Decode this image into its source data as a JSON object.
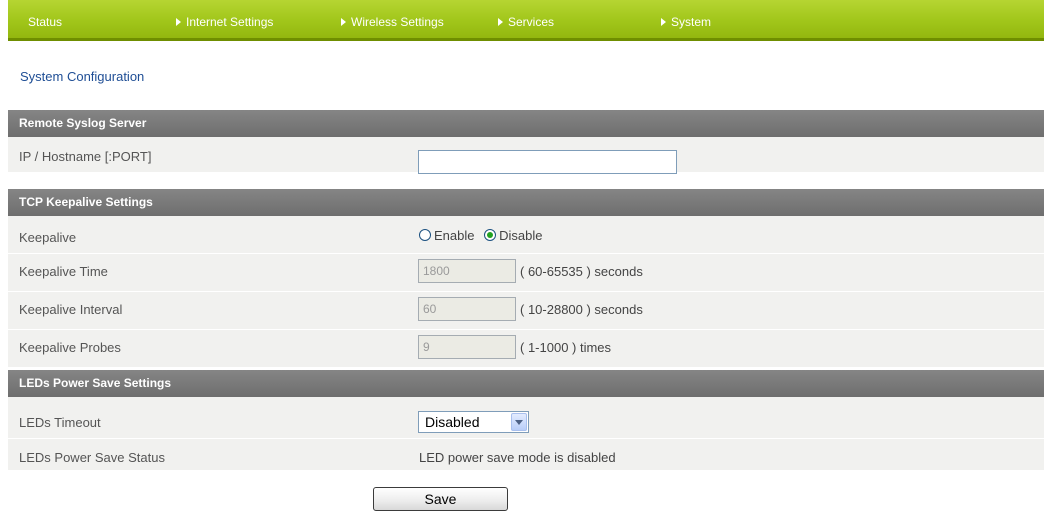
{
  "nav": {
    "items": [
      {
        "label": "Status",
        "arrow": false
      },
      {
        "label": "Internet Settings",
        "arrow": true
      },
      {
        "label": "Wireless Settings",
        "arrow": true
      },
      {
        "label": "Services",
        "arrow": true
      },
      {
        "label": "System",
        "arrow": true
      }
    ]
  },
  "page": {
    "title": "System Configuration"
  },
  "syslog": {
    "header": "Remote Syslog Server",
    "host_label": "IP / Hostname [:PORT]",
    "host_value": ""
  },
  "keepalive": {
    "header": "TCP Keepalive Settings",
    "keepalive_label": "Keepalive",
    "enable_label": "Enable",
    "disable_label": "Disable",
    "selected": "Disable",
    "time_label": "Keepalive Time",
    "time_value": "1800",
    "time_hint": "( 60-65535 ) seconds",
    "interval_label": "Keepalive Interval",
    "interval_value": "60",
    "interval_hint": "( 10-28800 ) seconds",
    "probes_label": "Keepalive Probes",
    "probes_value": "9",
    "probes_hint": "( 1-1000 ) times"
  },
  "leds": {
    "header": "LEDs Power Save Settings",
    "timeout_label": "LEDs Timeout",
    "timeout_value": "Disabled",
    "status_label": "LEDs Power Save Status",
    "status_value": "LED power save mode is disabled"
  },
  "actions": {
    "save_label": "Save"
  },
  "colors": {
    "nav_green": "#a1c61a",
    "section_header_gray": "#777777",
    "row_background": "#f1f1ef",
    "title_blue": "#1f4e95"
  },
  "icons": {
    "nav_arrow": "right-triangle-icon",
    "dropdown": "chevron-down-icon"
  }
}
